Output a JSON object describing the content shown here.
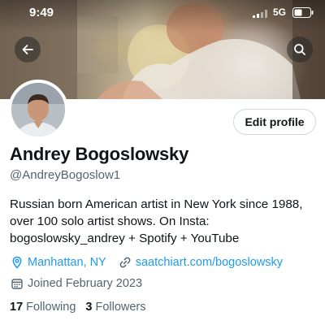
{
  "status": {
    "time": "9:49",
    "network": "5G"
  },
  "header": {
    "back_icon": "arrow-left-icon",
    "search_icon": "search-icon"
  },
  "profile": {
    "edit_label": "Edit profile",
    "display_name": "Andrey Bogoslowsky",
    "handle": "@AndreyBogoslow1",
    "bio_lines": [
      "Russian born American artist in New York since 1988,",
      "over 100 solo artist shows. On Insta:",
      "bogoslowsky_andrey + Spotify + YouTube"
    ],
    "location": "Manhattan, NY",
    "website": "saatchiart.com/bogoslowsky",
    "joined": "Joined February 2023",
    "following_count": "17",
    "following_label": "Following",
    "followers_count": "3",
    "followers_label": "Followers"
  },
  "colors": {
    "accent": "#1d9bf0",
    "secondary_text": "#536471"
  }
}
